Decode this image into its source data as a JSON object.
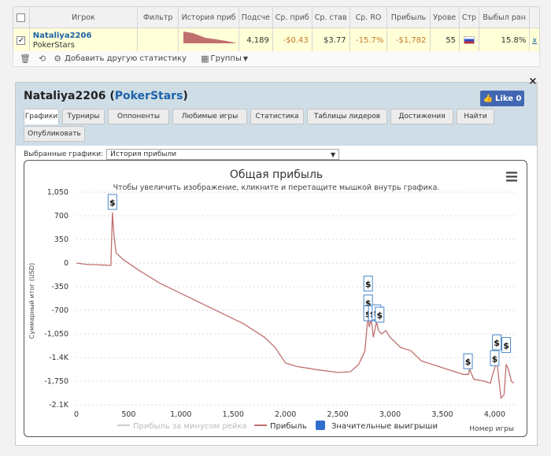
{
  "table": {
    "headers": [
      "Игрок",
      "Фильтр",
      "История приб",
      "Подсче",
      "Ср. приб",
      "Ср. став",
      "Ср. RO",
      "Прибыль",
      "Урове",
      "Стр",
      "Выбыл ран"
    ],
    "row": {
      "player": "Nataliya2206",
      "site": "PokerStars",
      "count": "4,189",
      "avg_profit": "-$0.43",
      "avg_stake": "$3.77",
      "avg_roi": "-15.7%",
      "profit": "-$1,782",
      "level": "55",
      "early_out": "15.8%",
      "remove": "x"
    }
  },
  "toolbar": {
    "add_stats": "Добавить другую статистику",
    "groups": "Группы"
  },
  "panel": {
    "title_name": "Nataliya2206",
    "title_site": "PokerStars",
    "like_label": "Like 0",
    "tabs": [
      "Графики",
      "Турниры",
      "Оппоненты",
      "Любимые игры",
      "Статистика",
      "Таблицы лидеров",
      "Достижения",
      "Найти",
      "Опубликовать"
    ],
    "select_label": "Выбранные графики:",
    "select_value": "История прибыли"
  },
  "chart_data": {
    "type": "line",
    "title": "Общая прибыль",
    "subtitle": "Чтобы увеличить изображение, кликните и перетащите мышкой внутрь графика.",
    "xlabel": "Номер игры",
    "ylabel": "Суммарный итог (USD)",
    "xlim": [
      0,
      4200
    ],
    "ylim": [
      -2100,
      1050
    ],
    "x_ticks": [
      "0",
      "500",
      "1,000",
      "1,500",
      "2,000",
      "2,500",
      "3,000",
      "3,500",
      "4,000"
    ],
    "x_tick_values": [
      0,
      500,
      1000,
      1500,
      2000,
      2500,
      3000,
      3500,
      4000
    ],
    "y_ticks": [
      "1,050",
      "700",
      "350",
      "0",
      "-350",
      "-700",
      "-1,050",
      "-1.4K",
      "-1,750",
      "-2.1K"
    ],
    "y_tick_values": [
      1050,
      700,
      350,
      0,
      -350,
      -700,
      -1050,
      -1400,
      -1750,
      -2100
    ],
    "series": [
      {
        "name": "Прибыль за минусом рейка",
        "color": "#cccccc",
        "visible": false,
        "points": []
      },
      {
        "name": "Прибыль",
        "color": "#c06f6f",
        "visible": true,
        "points": [
          [
            0,
            0
          ],
          [
            100,
            -20
          ],
          [
            200,
            -25
          ],
          [
            330,
            -35
          ],
          [
            345,
            750
          ],
          [
            360,
            400
          ],
          [
            380,
            150
          ],
          [
            450,
            50
          ],
          [
            600,
            -110
          ],
          [
            800,
            -300
          ],
          [
            1000,
            -450
          ],
          [
            1200,
            -600
          ],
          [
            1400,
            -750
          ],
          [
            1600,
            -900
          ],
          [
            1800,
            -1100
          ],
          [
            1900,
            -1250
          ],
          [
            2000,
            -1480
          ],
          [
            2100,
            -1530
          ],
          [
            2300,
            -1580
          ],
          [
            2500,
            -1620
          ],
          [
            2620,
            -1610
          ],
          [
            2700,
            -1500
          ],
          [
            2760,
            -1300
          ],
          [
            2790,
            -750
          ],
          [
            2800,
            -950
          ],
          [
            2820,
            -830
          ],
          [
            2840,
            -1100
          ],
          [
            2870,
            -870
          ],
          [
            2890,
            -1000
          ],
          [
            2920,
            -1050
          ],
          [
            2960,
            -1000
          ],
          [
            3000,
            -1100
          ],
          [
            3100,
            -1250
          ],
          [
            3200,
            -1300
          ],
          [
            3300,
            -1450
          ],
          [
            3400,
            -1500
          ],
          [
            3500,
            -1550
          ],
          [
            3600,
            -1600
          ],
          [
            3700,
            -1650
          ],
          [
            3750,
            -1650
          ],
          [
            3760,
            -1570
          ],
          [
            3800,
            -1720
          ],
          [
            3900,
            -1750
          ],
          [
            3960,
            -1780
          ],
          [
            3980,
            -1650
          ],
          [
            4000,
            -1560
          ],
          [
            4020,
            -1430
          ],
          [
            4060,
            -2000
          ],
          [
            4090,
            -1950
          ],
          [
            4110,
            -1500
          ],
          [
            4130,
            -1570
          ],
          [
            4160,
            -1750
          ],
          [
            4180,
            -1780
          ]
        ]
      },
      {
        "name": "Значительные выигрыши",
        "color": "#2f6fce",
        "visible": true,
        "points": [
          [
            345,
            900
          ],
          [
            2790,
            -310
          ],
          [
            2790,
            -590
          ],
          [
            2790,
            -750
          ],
          [
            2835,
            -750
          ],
          [
            2870,
            -735
          ],
          [
            2900,
            -770
          ],
          [
            3745,
            -1460
          ],
          [
            4000,
            -1415
          ],
          [
            4020,
            -1180
          ],
          [
            4110,
            -1220
          ]
        ]
      }
    ],
    "marker_label": "$",
    "grid": "horizontal-dotted",
    "legend_position": "bottom"
  }
}
